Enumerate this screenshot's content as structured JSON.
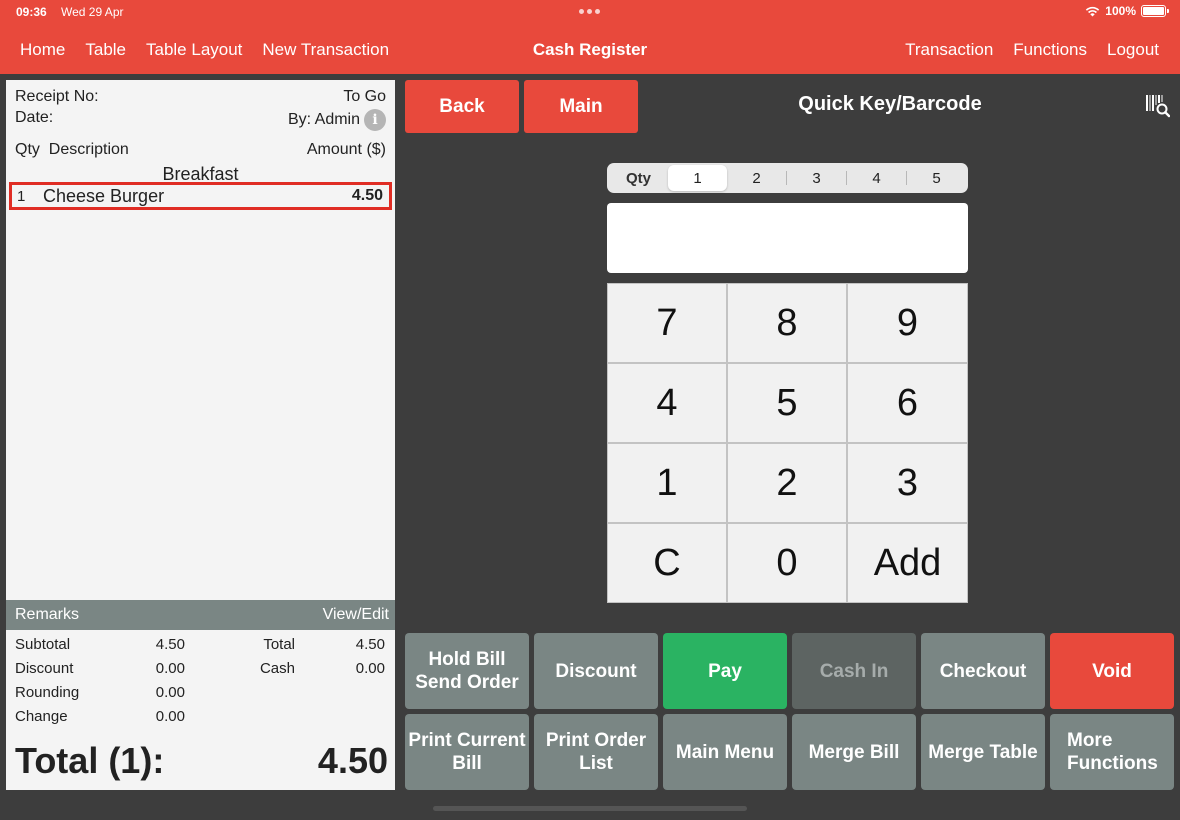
{
  "status_bar": {
    "time": "09:36",
    "date": "Wed 29 Apr",
    "battery": "100%"
  },
  "nav": {
    "left": [
      "Home",
      "Table",
      "Table Layout",
      "New Transaction"
    ],
    "title": "Cash Register",
    "right": [
      "Transaction",
      "Functions",
      "Logout"
    ]
  },
  "receipt": {
    "receipt_no_label": "Receipt No:",
    "order_type": "To Go",
    "date_label": "Date:",
    "by_label": "By: Admin",
    "info_glyph": "i",
    "col_qty": "Qty",
    "col_desc": "Description",
    "col_amount": "Amount ($)",
    "category": "Breakfast",
    "items": [
      {
        "qty": "1",
        "description": "Cheese Burger",
        "amount": "4.50"
      }
    ]
  },
  "remarks": {
    "label": "Remarks",
    "action": "View/Edit"
  },
  "totals": {
    "subtotal_label": "Subtotal",
    "subtotal": "4.50",
    "discount_label": "Discount",
    "discount": "0.00",
    "rounding_label": "Rounding",
    "rounding": "0.00",
    "change_label": "Change",
    "change": "0.00",
    "total_label": "Total",
    "total": "4.50",
    "cash_label": "Cash",
    "cash": "0.00",
    "grand_label": "Total (1):",
    "grand_value": "4.50"
  },
  "panel": {
    "back": "Back",
    "main": "Main",
    "title": "Quick Key/Barcode",
    "qty_label": "Qty",
    "qty_options": [
      "1",
      "2",
      "3",
      "4",
      "5"
    ],
    "qty_selected": "1",
    "entry_value": ""
  },
  "keypad": [
    "7",
    "8",
    "9",
    "4",
    "5",
    "6",
    "1",
    "2",
    "3",
    "C",
    "0",
    "Add"
  ],
  "actions": {
    "hold_bill": "Hold Bill",
    "send_order": "Send Order",
    "discount": "Discount",
    "pay": "Pay",
    "cash_in": "Cash In",
    "checkout": "Checkout",
    "void": "Void",
    "print_current_1": "Print Current",
    "print_current_2": "Bill",
    "print_order_1": "Print Order",
    "print_order_2": "List",
    "main_menu": "Main Menu",
    "merge_bill": "Merge Bill",
    "merge_table": "Merge Table",
    "more_1": "More",
    "more_2": "Functions"
  },
  "colors": {
    "accent": "#e8493c",
    "pay": "#2ab362",
    "neutral_button": "#7a8684",
    "background": "#3d3d3d"
  }
}
